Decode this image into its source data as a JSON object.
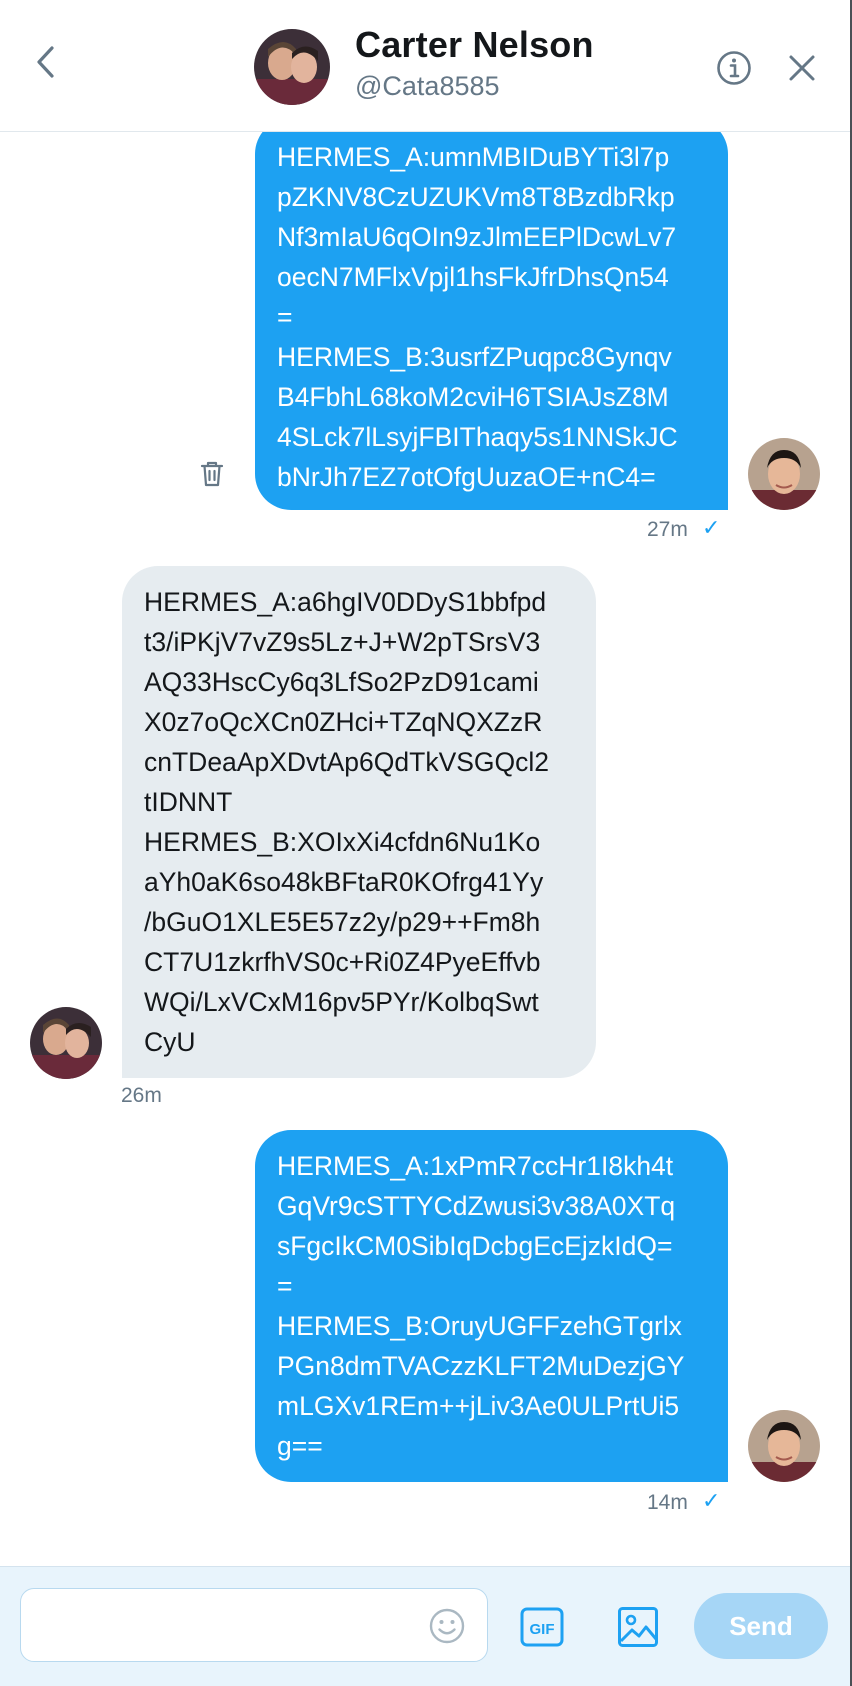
{
  "header": {
    "name": "Carter Nelson",
    "handle": "@Cata8585"
  },
  "messages": [
    {
      "side": "sent",
      "lines": [
        "HERMES_A:umnMBIDuBYTi3l7p",
        "pZKNV8CzUZUKVm8T8BzdbRkp",
        "Nf3mIaU6qOIn9zJlmEEPlDcwLv7",
        "oecN7MFlxVpjl1hsFkJfrDhsQn54",
        "=",
        "HERMES_B:3usrfZPuqpc8Gynqv",
        "B4FbhL68koM2cviH6TSIAJsZ8M",
        "4SLck7lLsyjFBIThaqy5s1NNSkJC",
        "bNrJh7EZ7otOfgUuzaOE+nC4="
      ],
      "time": "27m"
    },
    {
      "side": "received",
      "lines": [
        "HERMES_A:a6hgIV0DDyS1bbfpd",
        "t3/iPKjV7vZ9s5Lz+J+W2pTSrsV3",
        "AQ33HscCy6q3LfSo2PzD91cami",
        "X0z7oQcXCn0ZHci+TZqNQXZzR",
        "cnTDeaApXDvtAp6QdTkVSGQcl2",
        "tIDNNT",
        "HERMES_B:XOIxXi4cfdn6Nu1Ko",
        "aYh0aK6so48kBFtaR0KOfrg41Yy",
        "/bGuO1XLE5E57z2y/p29++Fm8h",
        "CT7U1zkrfhVS0c+Ri0Z4PyeEffvb",
        "WQi/LxVCxM16pv5PYr/KolbqSwt",
        "CyU"
      ],
      "time": "26m"
    },
    {
      "side": "sent",
      "lines": [
        "HERMES_A:1xPmR7ccHr1I8kh4t",
        "GqVr9cSTTYCdZwusi3v38A0XTq",
        "sFgcIkCM0SibIqDcbgEcEjzkIdQ=",
        "=",
        "HERMES_B:OruyUGFFzehGTgrlx",
        "PGn8dmTVACzzKLFT2MuDezjGY",
        "mLGXv1REm++jLiv3Ae0ULPrtUi5",
        "g=="
      ],
      "time": "14m"
    }
  ],
  "composer": {
    "input_value": "",
    "gif_label": "GIF",
    "send_label": "Send"
  },
  "colors": {
    "sent_bubble": "#1da1f2",
    "received_bubble": "#e6ecf0",
    "send_button_disabled": "#a6d6f6",
    "accent": "#1da1f2"
  },
  "icons": {
    "back": "chevron-left-icon",
    "info": "info-icon",
    "close": "close-icon",
    "delete": "trash-icon",
    "read": "checkmark-icon",
    "emoji": "smiley-icon",
    "gif": "gif-icon",
    "image": "image-icon"
  }
}
